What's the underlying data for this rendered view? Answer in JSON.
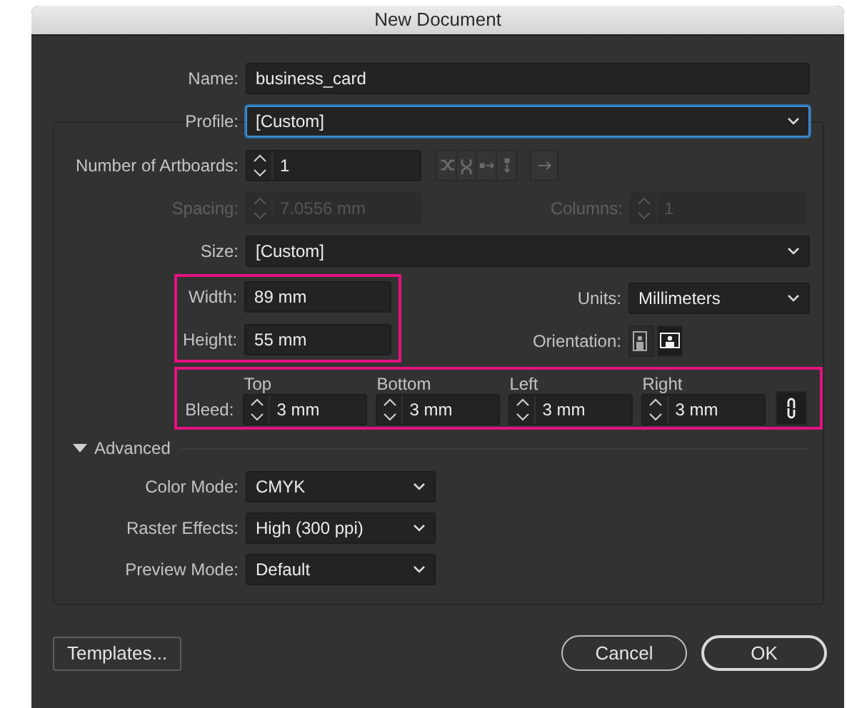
{
  "window": {
    "title": "New Document"
  },
  "name": {
    "label": "Name:",
    "value": "business_card"
  },
  "profile": {
    "label": "Profile:",
    "value": "[Custom]",
    "focused": true
  },
  "artboards": {
    "label": "Number of Artboards:",
    "value": "1"
  },
  "spacing": {
    "label": "Spacing:",
    "value": "7.0556 mm",
    "disabled": true
  },
  "columns": {
    "label": "Columns:",
    "value": "1",
    "disabled": true
  },
  "size": {
    "label": "Size:",
    "value": "[Custom]"
  },
  "dimensions": {
    "highlighted": true,
    "fields": [
      {
        "label": "Width:",
        "value": "89 mm"
      },
      {
        "label": "Height:",
        "value": "55 mm"
      }
    ]
  },
  "units": {
    "label": "Units:",
    "value": "Millimeters"
  },
  "orientation": {
    "label": "Orientation:",
    "options": [
      {
        "kind": "portrait",
        "selected": false
      },
      {
        "kind": "landscape",
        "selected": true
      }
    ]
  },
  "bleed": {
    "highlighted": true,
    "label": "Bleed:",
    "linked": true,
    "fields": [
      {
        "label": "Top",
        "value": "3 mm"
      },
      {
        "label": "Bottom",
        "value": "3 mm"
      },
      {
        "label": "Left",
        "value": "3 mm"
      },
      {
        "label": "Right",
        "value": "3 mm"
      }
    ]
  },
  "advanced": {
    "label": "Advanced",
    "expanded": true,
    "settings": [
      {
        "label": "Color Mode:",
        "value": "CMYK"
      },
      {
        "label": "Raster Effects:",
        "value": "High (300 ppi)"
      },
      {
        "label": "Preview Mode:",
        "value": "Default"
      }
    ]
  },
  "buttons": [
    {
      "label": "Templates...",
      "kind": "secondary"
    },
    {
      "label": "Cancel",
      "kind": "cancel"
    },
    {
      "label": "OK",
      "kind": "default"
    }
  ]
}
